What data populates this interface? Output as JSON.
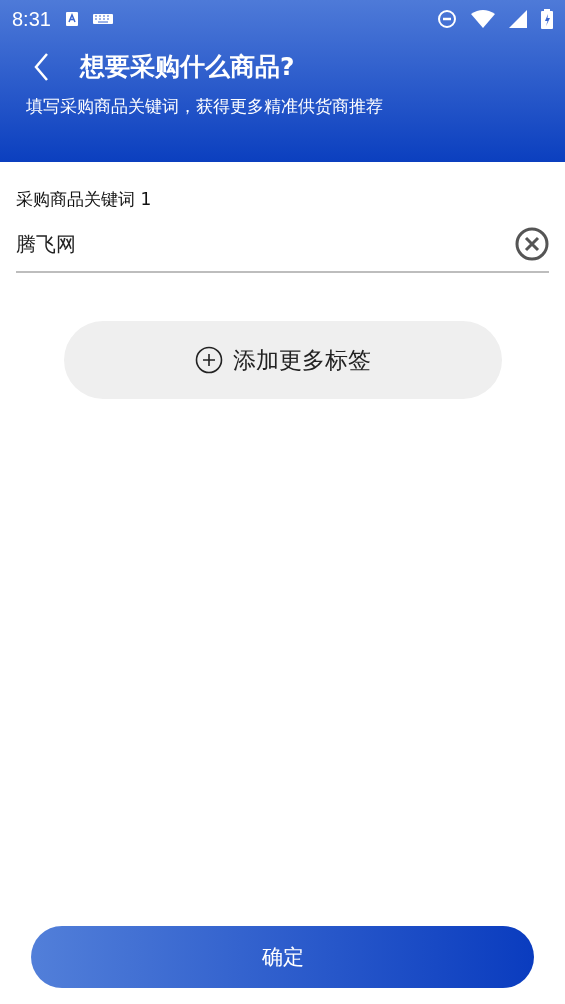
{
  "status_bar": {
    "time": "8:31"
  },
  "header": {
    "title": "想要采购什么商品?",
    "subtitle": "填写采购商品关键词，获得更多精准供货商推荐"
  },
  "keywords": [
    {
      "label": "采购商品关键词 1",
      "value": "腾飞网"
    }
  ],
  "add_button": {
    "label": "添加更多标签"
  },
  "confirm_button": {
    "label": "确定"
  }
}
